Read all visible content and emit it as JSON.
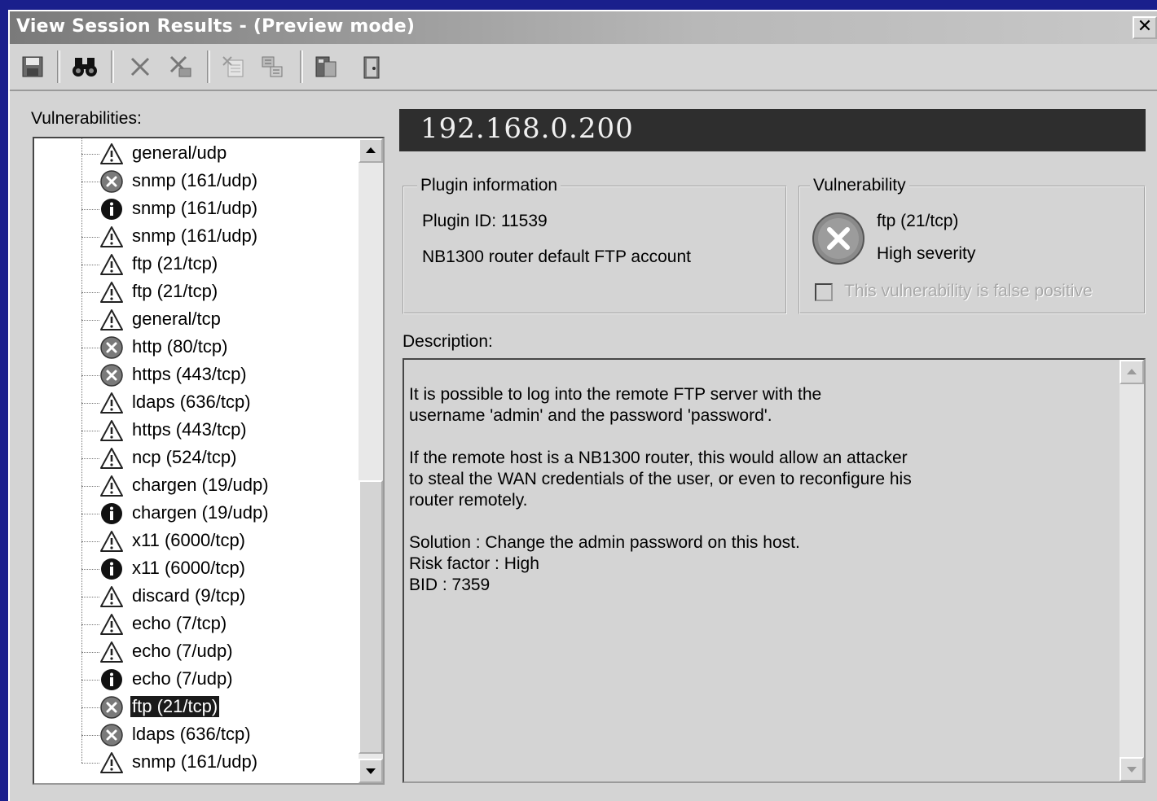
{
  "window": {
    "title": "View Session Results -  (Preview mode)",
    "close_label": "✕"
  },
  "toolbar": {
    "buttons": [
      {
        "name": "save-icon"
      },
      {
        "name": "find-icon"
      },
      {
        "name": "delete-icon"
      },
      {
        "name": "delete-all-icon"
      },
      {
        "name": "export-icon"
      },
      {
        "name": "report-icon"
      },
      {
        "name": "properties-icon"
      },
      {
        "name": "exit-icon"
      }
    ]
  },
  "vulnerabilities": {
    "label": "Vulnerabilities:",
    "items": [
      {
        "icon": "warning",
        "label": "general/udp"
      },
      {
        "icon": "high",
        "label": "snmp (161/udp)"
      },
      {
        "icon": "info",
        "label": "snmp (161/udp)"
      },
      {
        "icon": "warning",
        "label": "snmp (161/udp)"
      },
      {
        "icon": "warning",
        "label": "ftp (21/tcp)"
      },
      {
        "icon": "warning",
        "label": "ftp (21/tcp)"
      },
      {
        "icon": "warning",
        "label": "general/tcp"
      },
      {
        "icon": "high",
        "label": "http (80/tcp)"
      },
      {
        "icon": "high",
        "label": "https (443/tcp)"
      },
      {
        "icon": "warning",
        "label": "ldaps (636/tcp)"
      },
      {
        "icon": "warning",
        "label": "https (443/tcp)"
      },
      {
        "icon": "warning",
        "label": "ncp (524/tcp)"
      },
      {
        "icon": "warning",
        "label": "chargen (19/udp)"
      },
      {
        "icon": "info",
        "label": "chargen (19/udp)"
      },
      {
        "icon": "warning",
        "label": "x11 (6000/tcp)"
      },
      {
        "icon": "info",
        "label": "x11 (6000/tcp)"
      },
      {
        "icon": "warning",
        "label": "discard (9/tcp)"
      },
      {
        "icon": "warning",
        "label": "echo (7/tcp)"
      },
      {
        "icon": "warning",
        "label": "echo (7/udp)"
      },
      {
        "icon": "info",
        "label": "echo (7/udp)"
      },
      {
        "icon": "high",
        "label": "ftp (21/tcp)",
        "selected": true
      },
      {
        "icon": "high",
        "label": "ldaps (636/tcp)"
      },
      {
        "icon": "warning",
        "label": "snmp (161/udp)"
      }
    ]
  },
  "host": {
    "ip": "192.168.0.200"
  },
  "plugin": {
    "legend": "Plugin information",
    "id_text": "Plugin ID: 11539",
    "name": "NB1300 router default FTP account"
  },
  "vulnerability": {
    "legend": "Vulnerability",
    "port": "ftp (21/tcp)",
    "severity": "High severity",
    "false_positive_label": "This vulnerability is false positive",
    "false_positive_checked": false
  },
  "description": {
    "label": "Description:",
    "text": "It is possible to log into the remote FTP server with the\nusername 'admin' and the password 'password'.\n\nIf the remote host is a NB1300 router, this would allow an attacker\nto steal the WAN credentials of the user, or even to reconfigure his\nrouter remotely.\n\nSolution : Change the admin password on this host.\nRisk factor : High\nBID : 7359"
  },
  "colors": {
    "desktop": "#1a1f8c",
    "window_bg": "#d4d4d4",
    "ip_bar_bg": "#2e2e2e",
    "selected_bg": "#1a1a1a"
  }
}
